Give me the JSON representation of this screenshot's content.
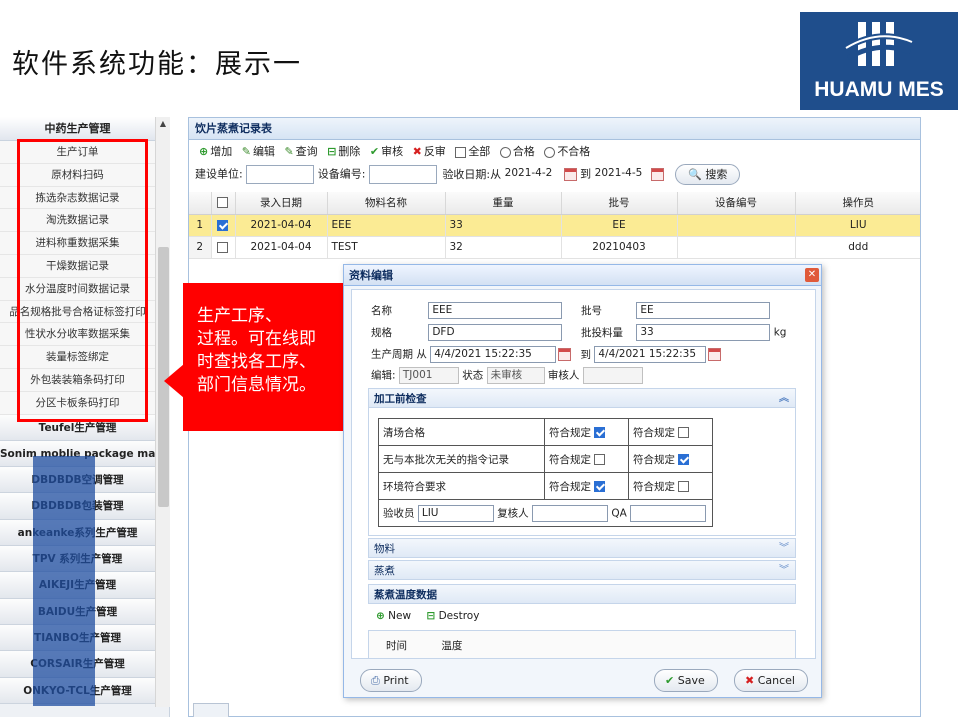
{
  "slide": {
    "title": "软件系统功能：展示一"
  },
  "logo": {
    "text": "HUAMU MES"
  },
  "menu": {
    "top_header": "中药生产管理",
    "items": [
      "生产订单",
      "原材料扫码",
      "拣选杂志数据记录",
      "淘洗数据记录",
      "进料称重数据采集",
      "干燥数据记录",
      "水分温度时间数据记录",
      "品名规格批号合格证标签打印",
      "性状水分收率数据采集",
      "装量标签绑定",
      "外包装装箱条码打印",
      "分区卡板条码打印"
    ],
    "groups": [
      "Teufel生产管理",
      "Sonim moblie package manage",
      "DBDBDB空调管理",
      "DBDBDB包装管理",
      "ankeanke系列生产管理",
      "TPV 系列生产管理",
      "AIKEJI生产管理",
      "BAIDU生产管理",
      "TIANBO生产管理",
      "CORSAIR生产管理",
      "ONKYO-TCL生产管理"
    ]
  },
  "callout": {
    "lines": [
      "生产工序、",
      "过程。可在线即",
      "时查找各工序、",
      "部门信息情况。"
    ]
  },
  "panel": {
    "title": "饮片蒸煮记录表",
    "toolbar": {
      "add": "增加",
      "edit": "编辑",
      "query": "查询",
      "delete": "删除",
      "audit": "审核",
      "unaudit": "反审",
      "all": "全部",
      "pass": "合格",
      "fail": "不合格"
    },
    "filter": {
      "unit_label": "建设单位:",
      "unit_value": "",
      "device_label": "设备编号:",
      "device_value": "",
      "date_label": "验收日期:从",
      "date_from": "2021-4-2",
      "date_to_label": "到",
      "date_to": "2021-4-5",
      "search": "搜索"
    },
    "columns": [
      "录入日期",
      "物料名称",
      "重量",
      "批号",
      "设备编号",
      "操作员"
    ],
    "rows": [
      {
        "n": "1",
        "checked": true,
        "date": "2021-04-04",
        "material": "EEE",
        "weight": "33",
        "batch": "EE",
        "device": "",
        "operator": "LIU"
      },
      {
        "n": "2",
        "checked": false,
        "date": "2021-04-04",
        "material": "TEST",
        "weight": "32",
        "batch": "20210403",
        "device": "",
        "operator": "ddd"
      }
    ]
  },
  "dialog": {
    "title": "资料编辑",
    "name_label": "名称",
    "name_value": "EEE",
    "batch_label": "批号",
    "batch_value": "EE",
    "spec_label": "规格",
    "spec_value": "DFD",
    "qty_label": "批投料量",
    "qty_value": "33",
    "qty_unit": "kg",
    "cycle_label": "生产周期",
    "cycle_from_label": "从",
    "cycle_from": "4/4/2021 15:22:35",
    "cycle_to_label": "到",
    "cycle_to": "4/4/2021 15:22:35",
    "code_label": "编辑:",
    "code_value": "TJ001",
    "status_label": "状态",
    "status_value": "未审核",
    "auditor_label": "审核人",
    "auditor_value": "",
    "section_precheck": "加工前检查",
    "checks": [
      {
        "item": "清场合格",
        "a_label": "符合规定",
        "a": true,
        "b_label": "符合规定",
        "b": false
      },
      {
        "item": "无与本批次无关的指令记录",
        "a_label": "符合规定",
        "a": false,
        "b_label": "符合规定",
        "b": true
      },
      {
        "item": "环境符合要求",
        "a_label": "符合规定",
        "a": true,
        "b_label": "符合规定",
        "b": false
      }
    ],
    "inspector_label": "验收员",
    "inspector_value": "LIU",
    "reviewer_label": "复核人",
    "reviewer_value": "",
    "qa_label": "QA",
    "qa_value": "",
    "section_material": "物料",
    "section_steam": "蒸煮",
    "section_temp": "蒸煮温度数据",
    "new": "New",
    "destroy": "Destroy",
    "col_time": "时间",
    "col_temp": "温度",
    "print": "Print",
    "save": "Save",
    "cancel": "Cancel"
  },
  "colors": {
    "accent": "#1f4e8c",
    "callout": "#ff0000",
    "selected_row": "#fbeb94"
  }
}
